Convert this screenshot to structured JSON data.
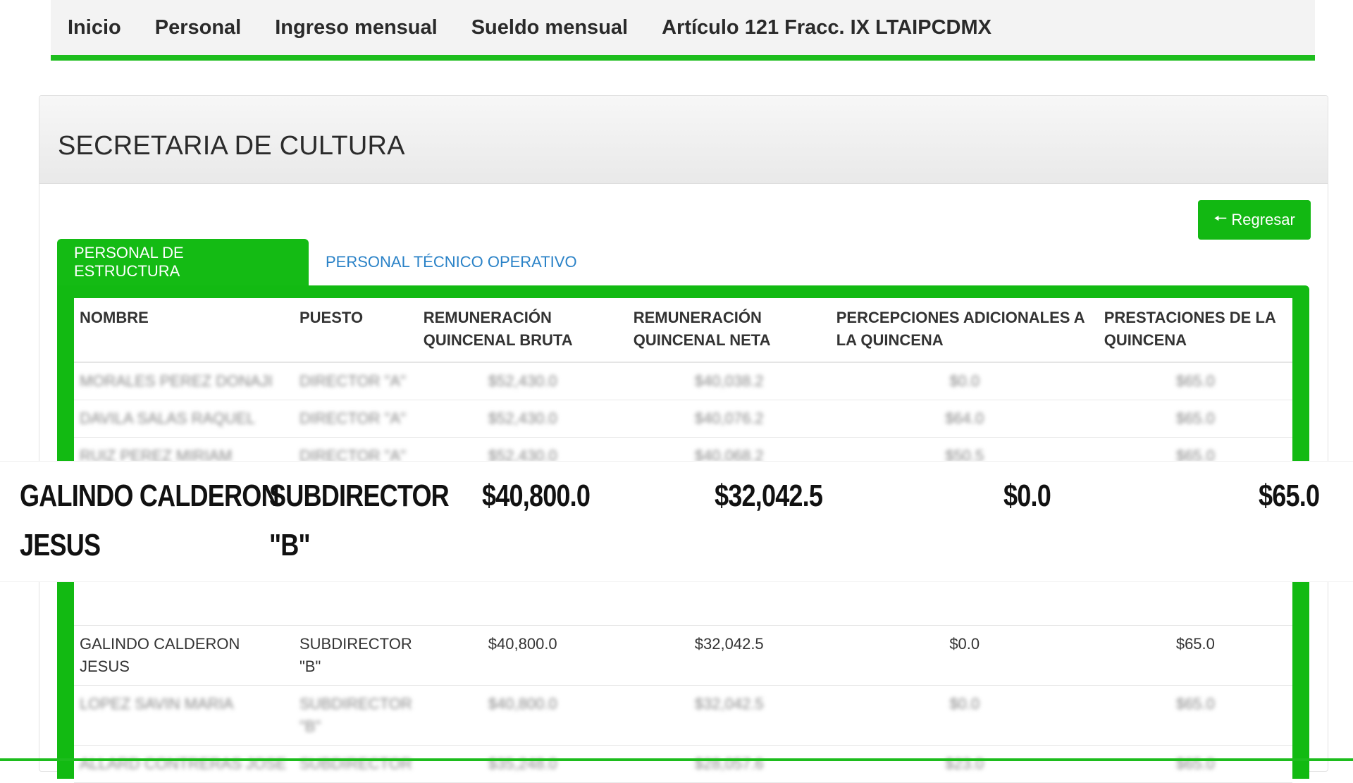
{
  "nav": {
    "items": [
      "Inicio",
      "Personal",
      "Ingreso mensual",
      "Sueldo mensual",
      "Artículo 121 Fracc. IX LTAIPCDMX"
    ]
  },
  "panel": {
    "title": "SECRETARIA DE CULTURA",
    "back_label": "Regresar",
    "back_icon": "arrow-left-icon"
  },
  "tabs": {
    "active": "PERSONAL DE ESTRUCTURA",
    "inactive": "PERSONAL TÉCNICO OPERATIVO"
  },
  "table": {
    "headers": [
      "NOMBRE",
      "PUESTO",
      "REMUNERACIÓN QUINCENAL BRUTA",
      "REMUNERACIÓN QUINCENAL NETA",
      "PERCEPCIONES ADICIONALES A LA QUINCENA",
      "PRESTACIONES DE LA QUINCENA"
    ],
    "rows": [
      {
        "blurred": true,
        "cells": [
          "MORALES PEREZ DONAJI",
          "DIRECTOR \"A\"",
          "$52,430.0",
          "$40,038.2",
          "$0.0",
          "$65.0"
        ]
      },
      {
        "blurred": true,
        "cells": [
          "DAVILA SALAS RAQUEL",
          "DIRECTOR \"A\"",
          "$52,430.0",
          "$40,076.2",
          "$64.0",
          "$65.0"
        ]
      },
      {
        "blurred": true,
        "cells": [
          "RUIZ PEREZ MIRIAM",
          "DIRECTOR \"A\"",
          "$52,430.0",
          "$40,068.2",
          "$50.5",
          "$65.0"
        ]
      },
      {
        "blurred": false,
        "cells": [
          "GALINDO CALDERON JESUS",
          "SUBDIRECTOR \"B\"",
          "$40,800.0",
          "$32,042.5",
          "$0.0",
          "$65.0"
        ]
      },
      {
        "blurred": true,
        "cells": [
          "LOPEZ SAVIN MARIA",
          "SUBDIRECTOR \"B\"",
          "$40,800.0",
          "$32,042.5",
          "$0.0",
          "$65.0"
        ]
      },
      {
        "blurred": true,
        "cells": [
          "ALLARD CONTRERAS JOSE",
          "SUBDIRECTOR",
          "$35,248.0",
          "$28,057.6",
          "$23.0",
          "$65.0"
        ]
      }
    ]
  },
  "zoom": {
    "name_line1": "GALINDO CALDERON",
    "name_line2": "JESUS",
    "puesto_line1": "SUBDIRECTOR",
    "puesto_line2": "\"B\"",
    "bruta": "$40,800.0",
    "neta": "$32,042.5",
    "percepciones": "$0.0",
    "prestaciones": "$65.0"
  },
  "colors": {
    "accent_green": "#12b812",
    "link_blue": "#2a82c7"
  }
}
